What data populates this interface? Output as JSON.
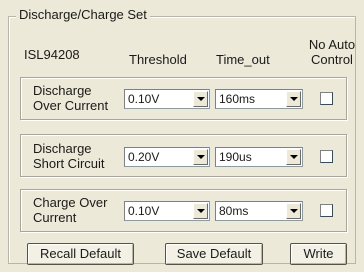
{
  "panel": {
    "title": "Discharge/Charge Set"
  },
  "headers": {
    "device": "ISL94208",
    "threshold": "Threshold",
    "timeout": "Time_out",
    "noauto_line1": "No Auto",
    "noauto_line2": "Control"
  },
  "rows": [
    {
      "label_line1": "Discharge",
      "label_line2": "Over Current",
      "threshold": "0.10V",
      "timeout": "160ms",
      "no_auto_control": false
    },
    {
      "label_line1": "Discharge",
      "label_line2": "Short Circuit",
      "threshold": "0.20V",
      "timeout": "190us",
      "no_auto_control": false
    },
    {
      "label_line1": "Charge Over",
      "label_line2": "Current",
      "threshold": "0.10V",
      "timeout": "80ms",
      "no_auto_control": false
    }
  ],
  "buttons": {
    "recall_default": "Recall Default",
    "save_default": "Save Default",
    "write": "Write"
  }
}
